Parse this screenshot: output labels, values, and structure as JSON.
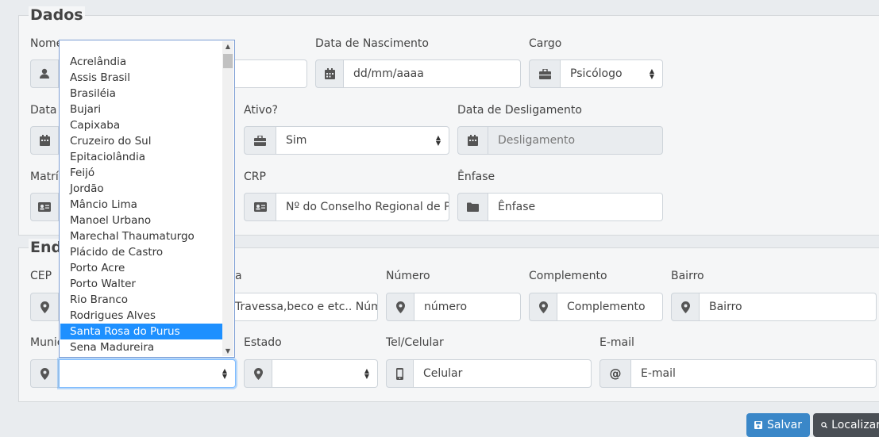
{
  "dados": {
    "legend": "Dados",
    "nome_label": "Nome",
    "nascimento_label": "Data de Nascimento",
    "nascimento_placeholder": "dd/mm/aaaa",
    "cargo_label": "Cargo",
    "cargo_value": "Psicólogo",
    "data_label_partial": "Data d",
    "ativo_label": "Ativo?",
    "ativo_value": "Sim",
    "desligamento_label": "Data de Desligamento",
    "desligamento_placeholder": "Desligamento",
    "matricula_label_partial": "Matríc",
    "crp_label": "CRP",
    "crp_placeholder": "Nº do Conselho Regional de Ps",
    "enfase_label": "Ênfase",
    "enfase_placeholder": "Ênfase"
  },
  "endereco": {
    "legend_partial": "End",
    "cep_label": "CEP",
    "rua_label_partial": "a",
    "rua_placeholder_partial": "Travessa,beco e etc.. Núme",
    "numero_label": "Número",
    "numero_placeholder": "número",
    "complemento_label": "Complemento",
    "complemento_placeholder": "Complemento",
    "bairro_label": "Bairro",
    "bairro_placeholder": "Bairro",
    "municipio_label_partial": "Munic",
    "municipio_value": "",
    "estado_label": "Estado",
    "estado_value": "",
    "tel_label": "Tel/Celular",
    "tel_placeholder": "Celular",
    "email_label": "E-mail",
    "email_placeholder": "E-mail",
    "email_addon": "@"
  },
  "dropdown": {
    "options": [
      "Acrelândia",
      "Assis Brasil",
      "Brasiléia",
      "Bujari",
      "Capixaba",
      "Cruzeiro do Sul",
      "Epitaciolândia",
      "Feijó",
      "Jordão",
      "Mâncio Lima",
      "Manoel Urbano",
      "Marechal Thaumaturgo",
      "Plácido de Castro",
      "Porto Acre",
      "Porto Walter",
      "Rio Branco",
      "Rodrigues Alves",
      "Santa Rosa do Purus",
      "Sena Madureira"
    ],
    "selected": "Santa Rosa do Purus"
  },
  "buttons": {
    "salvar": "Salvar",
    "localizar_partial": "Localizar"
  },
  "colors": {
    "highlight": "#1e90ff",
    "primary": "#3a87c8",
    "dark": "#4a4f55"
  }
}
